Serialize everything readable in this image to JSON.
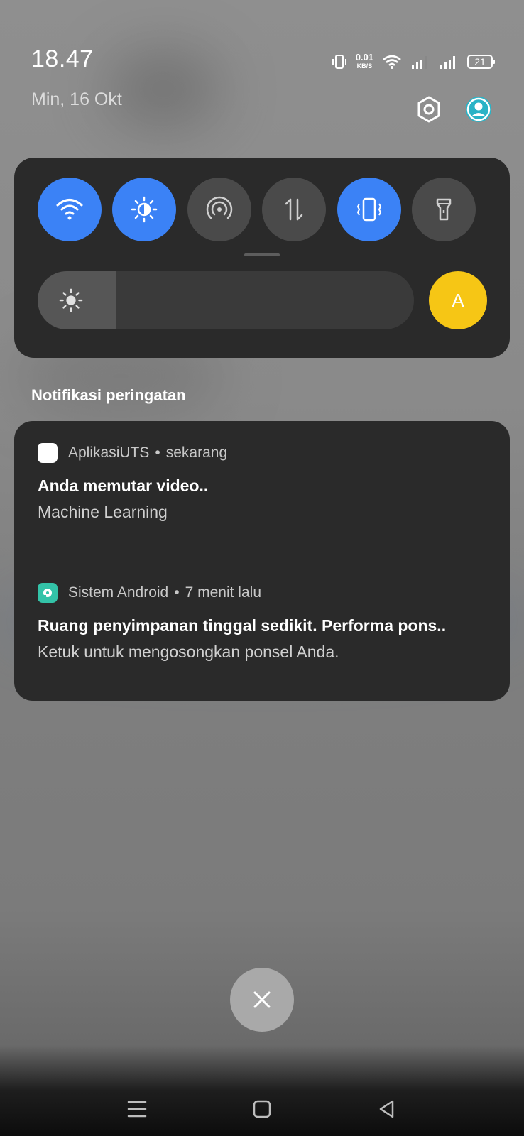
{
  "status": {
    "time": "18.47",
    "date": "Min, 16 Okt",
    "net_speed_value": "0.01",
    "net_speed_unit": "KB/S",
    "battery": "21"
  },
  "icons": {
    "vibrate": "vibrate-icon",
    "wifi": "wifi-icon",
    "signal": "signal-icon",
    "battery": "battery-icon",
    "settings": "gear-icon",
    "account": "account-icon"
  },
  "quick_settings": {
    "tiles": [
      {
        "icon": "wifi-icon",
        "active": true
      },
      {
        "icon": "brightness-mode-icon",
        "active": true
      },
      {
        "icon": "hotspot-icon",
        "active": false
      },
      {
        "icon": "mobile-data-icon",
        "active": false
      },
      {
        "icon": "vibrate-icon",
        "active": true
      },
      {
        "icon": "flashlight-icon",
        "active": false
      }
    ],
    "brightness_level": 0.21,
    "auto_brightness_label": "A"
  },
  "colors": {
    "accent": "#3b82f6",
    "auto_brightness": "#f6c615",
    "panel": "#2a2a2a"
  },
  "notifications": {
    "section_title": "Notifikasi peringatan",
    "items": [
      {
        "app": "AplikasiUTS",
        "time": "sekarang",
        "title": "Anda memutar video..",
        "text": "Machine Learning"
      },
      {
        "app": "Sistem Android",
        "time": "7 menit lalu",
        "title": "Ruang penyimpanan tinggal sedikit. Performa pons..",
        "text": "Ketuk untuk mengosongkan ponsel Anda."
      }
    ]
  }
}
